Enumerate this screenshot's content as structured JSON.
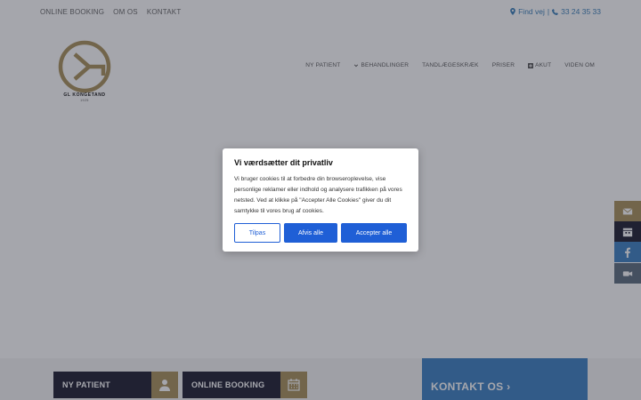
{
  "topbar": {
    "links": [
      "ONLINE BOOKING",
      "OM OS",
      "KONTAKT"
    ],
    "find_vej": "Find vej",
    "divider": "|",
    "phone": "33 24 35 33"
  },
  "logo": {
    "name": "GL KONGETAND",
    "since": "1925"
  },
  "mainnav": {
    "items": [
      "NY PATIENT",
      "BEHANDLINGER",
      "TANDLÆGESKRÆK",
      "PRISER",
      "AKUT",
      "VIDEN OM"
    ]
  },
  "bottom": {
    "ny_patient": "NY PATIENT",
    "online_booking": "ONLINE BOOKING",
    "kontakt": "KONTAKT OS ›"
  },
  "side_tabs": [
    {
      "icon": "envelope-icon",
      "color": "#a89058"
    },
    {
      "icon": "calendar-icon",
      "color": "#1a1a2e"
    },
    {
      "icon": "facebook-icon",
      "color": "#3a7fc1"
    },
    {
      "icon": "video-camera-icon",
      "color": "#5a6b7d"
    }
  ],
  "cookie": {
    "title": "Vi værdsætter dit privatliv",
    "body": "Vi bruger cookies til at forbedre din browseroplevelse, vise personlige reklamer eller indhold og analysere trafikken på vores netsted. Ved at klikke på \"Accepter Alle Cookies\" giver du dit samtykke til vores brug af cookies.",
    "customize": "Tilpas",
    "reject": "Afvis alle",
    "accept": "Accepter alle"
  },
  "colors": {
    "gold": "#a89058",
    "navy": "#1a1a2e",
    "blue": "#3a7fc1",
    "button_blue": "#1f5fd6"
  }
}
